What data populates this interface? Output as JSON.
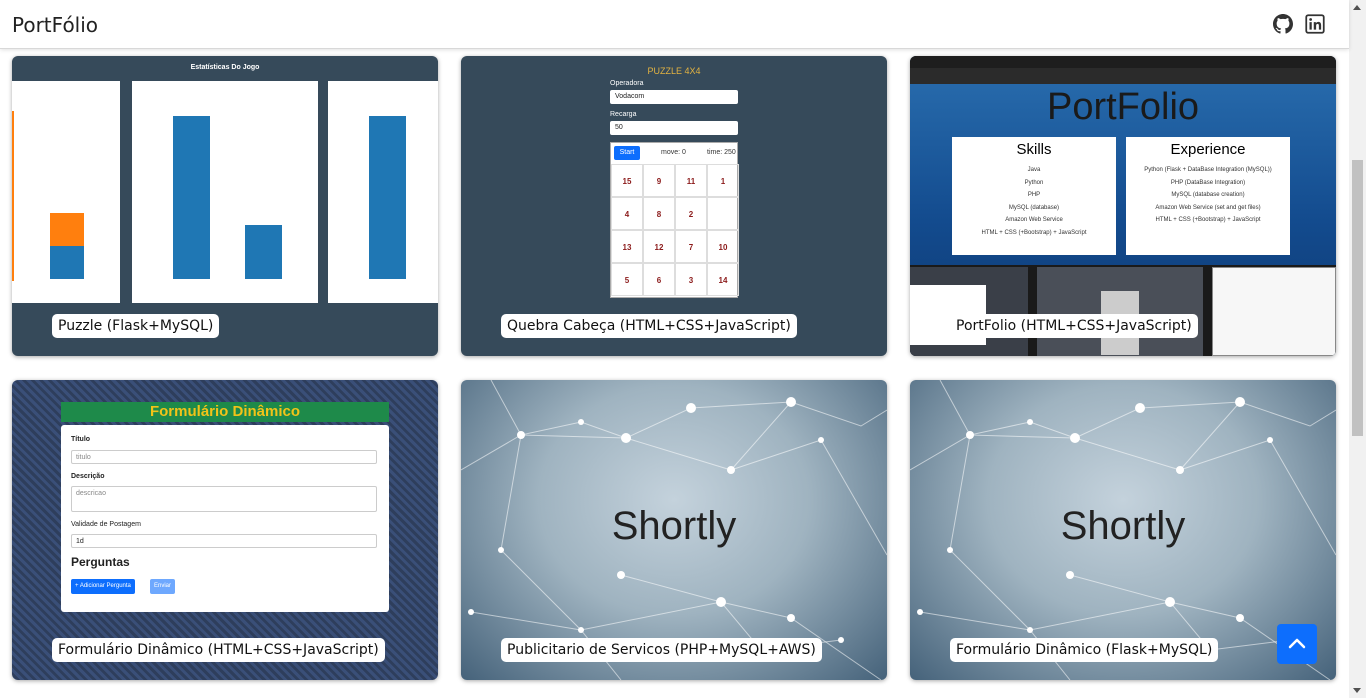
{
  "navbar": {
    "brand": "PortFólio",
    "icons": [
      "github-icon",
      "linkedin-icon"
    ]
  },
  "projects": [
    {
      "caption": "Puzzle (Flask+MySQL)",
      "preview": {
        "title": "Estatísticas Do Jogo"
      }
    },
    {
      "caption": "Quebra Cabeça (HTML+CSS+JavaScript)",
      "preview": {
        "title": "PUZZLE 4X4",
        "operator_label": "Operadora",
        "operator_value": "Vodacom",
        "recharge_label": "Recarga",
        "recharge_value": "50",
        "start_label": "Start",
        "move_label": "move: 0",
        "time_label": "time: 250",
        "tiles": [
          "15",
          "9",
          "11",
          "1",
          "4",
          "8",
          "2",
          "",
          "13",
          "12",
          "7",
          "10",
          "5",
          "6",
          "3",
          "14"
        ]
      }
    },
    {
      "caption": "PortFolio (HTML+CSS+JavaScript)",
      "preview": {
        "title": "PortFolio",
        "skills_title": "Skills",
        "skills": [
          "Java",
          "Python",
          "PHP",
          "MySQL (database)",
          "Amazon Web Service",
          "HTML + CSS (+Bootstrap) + JavaScript"
        ],
        "experience_title": "Experience",
        "experience": [
          "Python (Flask + DataBase Integration (MySQL))",
          "PHP (DataBase Integration)",
          "MySQL (database creation)",
          "Amazon Web Service (set and get files)",
          "HTML + CSS (+Bootstrap) + JavaScript"
        ]
      }
    },
    {
      "caption": "Formulário Dinâmico (HTML+CSS+JavaScript)",
      "preview": {
        "title": "Formulário Dinâmico",
        "title_label": "Título",
        "title_placeholder": "titulo",
        "desc_label": "Descrição",
        "desc_placeholder": "descricao",
        "validity_label": "Validade de Postagem",
        "validity_value": "1d",
        "questions_title": "Perguntas",
        "add_label": "+ Adicionar Pergunta",
        "send_label": "Enviar"
      }
    },
    {
      "caption": "Publicitario de Servicos (PHP+MySQL+AWS)",
      "preview": {
        "title": "Shortly"
      }
    },
    {
      "caption": "Formulário Dinâmico (Flask+MySQL)",
      "preview": {
        "title": "Shortly"
      }
    }
  ],
  "colors": {
    "accent": "#0d6efd",
    "card_dark": "#364a5a",
    "puzzle_title": "#e3b341",
    "form_header": "#1e8a4a"
  }
}
